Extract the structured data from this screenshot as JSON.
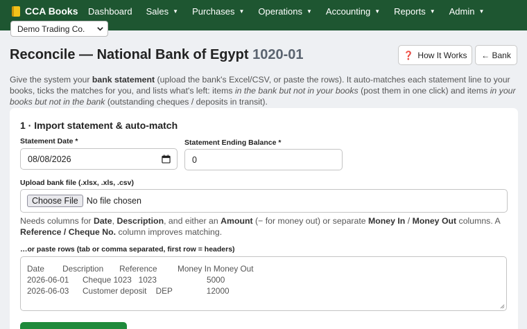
{
  "brand": {
    "name": "CCA Books",
    "icon": "ledger-book-icon"
  },
  "nav": {
    "items": [
      {
        "label": "Dashboard",
        "dropdown": false
      },
      {
        "label": "Sales",
        "dropdown": true
      },
      {
        "label": "Purchases",
        "dropdown": true
      },
      {
        "label": "Operations",
        "dropdown": true
      },
      {
        "label": "Accounting",
        "dropdown": true
      },
      {
        "label": "Reports",
        "dropdown": true
      },
      {
        "label": "Admin",
        "dropdown": true
      }
    ]
  },
  "company_select": {
    "value": "Demo Trading Co."
  },
  "page": {
    "title": "Reconcile — National Bank of Egypt",
    "account_code": "1020-01",
    "how_it_works_label": "How It Works",
    "back_label": "← Bank",
    "intro": {
      "p1": "Give the system your ",
      "b1": "bank statement",
      "p2": " (upload the bank's Excel/CSV, or paste the rows). It auto-matches each statement line to your books, ticks the matches for you, and lists what's left: items ",
      "i1": "in the bank but not in your books",
      "p3": " (post them in one click) and items ",
      "i2": "in your books but not in the bank",
      "p4": " (outstanding cheques / deposits in transit)."
    }
  },
  "import_card": {
    "title": "1 · Import statement & auto-match",
    "statement_date_label": "Statement Date *",
    "statement_date_value": "08/08/2026",
    "ending_balance_label": "Statement Ending Balance *",
    "ending_balance_value": "0",
    "upload_label": "Upload bank file (.xlsx, .xls, .csv)",
    "choose_file_label": "Choose File",
    "no_file_text": "No file chosen",
    "help": {
      "p1": "Needs columns for ",
      "b1": "Date",
      "p2": ", ",
      "b2": "Description",
      "p3": ", and either an ",
      "b3": "Amount",
      "p4": " (− for money out) or separate ",
      "b4": "Money In",
      "p5": " / ",
      "b5": "Money Out",
      "p6": " columns. A ",
      "b6": "Reference / Cheque No.",
      "p7": " column improves matching."
    },
    "paste_label": "…or paste rows (tab or comma separated, first row = headers)",
    "paste_placeholder": "Date        Description       Reference         Money In Money Out\n2026-06-01      Cheque 1023   1023                      5000\n2026-06-03      Customer deposit    DEP               12000"
  },
  "colors": {
    "navbar": "#1e5631",
    "primary_button": "#1f8a3b"
  }
}
